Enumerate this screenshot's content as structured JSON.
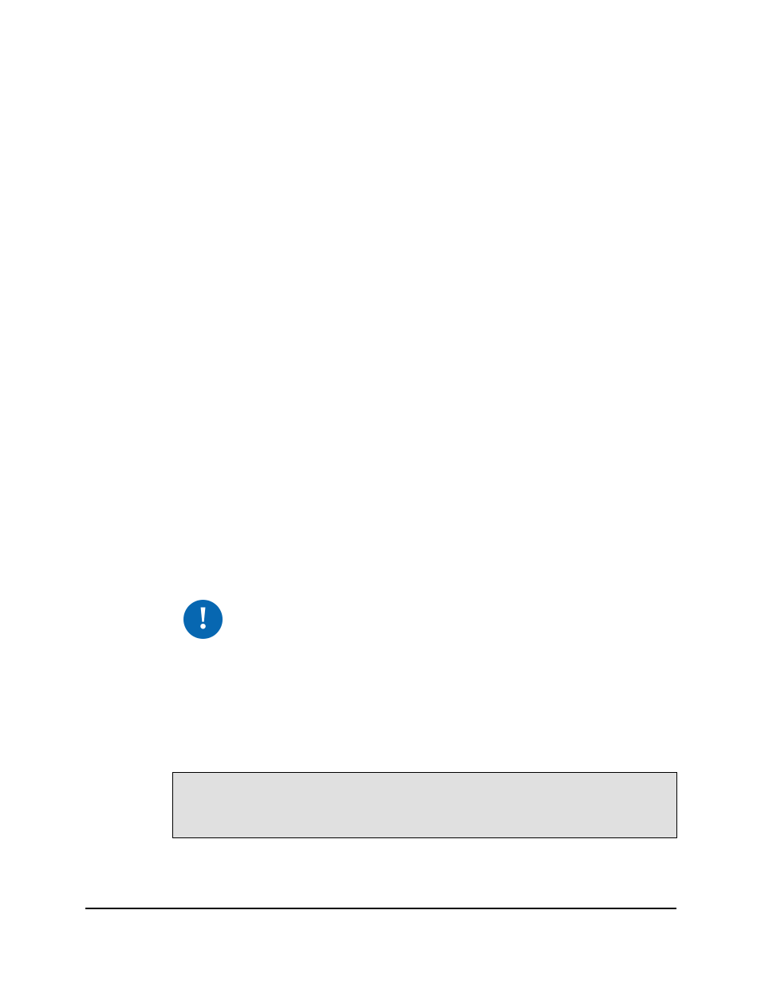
{
  "icon": {
    "name": "notice-icon",
    "glyph": "!"
  },
  "box": {
    "present": true
  }
}
